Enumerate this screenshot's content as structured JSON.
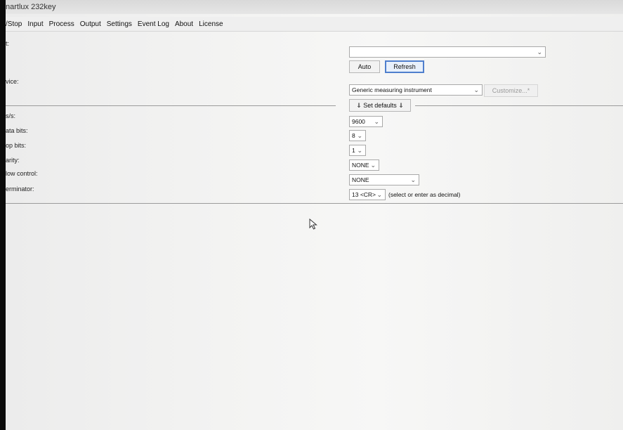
{
  "app": {
    "title": "nartlux 232key"
  },
  "menu": {
    "items": [
      {
        "label": "/Stop"
      },
      {
        "label": "Input"
      },
      {
        "label": "Process"
      },
      {
        "label": "Output"
      },
      {
        "label": "Settings"
      },
      {
        "label": "Event Log"
      },
      {
        "label": "About"
      },
      {
        "label": "License"
      }
    ]
  },
  "form": {
    "port_label": "t:",
    "port_value": "",
    "auto_label": "Auto",
    "refresh_label": "Refresh",
    "device_label": "vice:",
    "device_value": "Generic measuring instrument",
    "customize_label": "Customize...*",
    "set_defaults_label": "⇓ Set defaults ⇓",
    "baud_label": "s/s:",
    "baud_value": "9600",
    "databits_label": "ata bits:",
    "databits_value": "8",
    "stopbits_label": "op bits:",
    "stopbits_value": "1",
    "parity_label": "arity:",
    "parity_value": "NONE",
    "flow_label": "low control:",
    "flow_value": "NONE",
    "terminator_label": "erminator:",
    "terminator_value": "13 <CR>",
    "terminator_hint": "(select or enter as decimal)"
  }
}
